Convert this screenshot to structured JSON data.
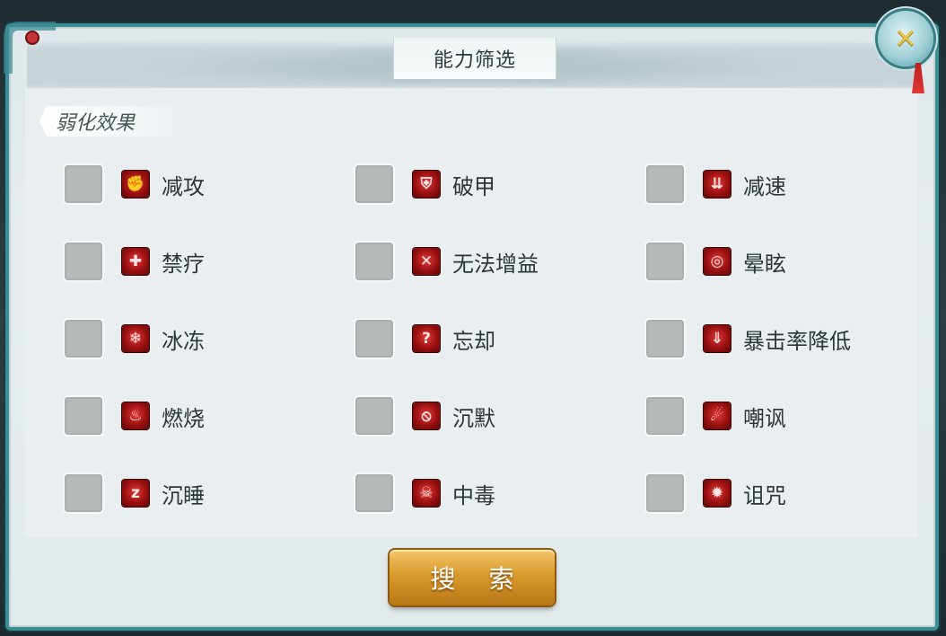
{
  "dialog": {
    "title": "能力筛选",
    "section_label": "弱化效果",
    "search_label": "搜 索",
    "close_icon": "✕"
  },
  "options": [
    {
      "label": "减攻",
      "icon": "attack-down-icon",
      "glyph": "✊",
      "checked": false
    },
    {
      "label": "破甲",
      "icon": "armor-break-icon",
      "glyph": "⛨",
      "checked": false
    },
    {
      "label": "减速",
      "icon": "slow-icon",
      "glyph": "⇊",
      "checked": false
    },
    {
      "label": "禁疗",
      "icon": "heal-block-icon",
      "glyph": "✚",
      "checked": false
    },
    {
      "label": "无法增益",
      "icon": "buff-block-icon",
      "glyph": "✕",
      "checked": false
    },
    {
      "label": "晕眩",
      "icon": "stun-icon",
      "glyph": "◎",
      "checked": false
    },
    {
      "label": "冰冻",
      "icon": "freeze-icon",
      "glyph": "❄",
      "checked": false
    },
    {
      "label": "忘却",
      "icon": "forget-icon",
      "glyph": "?",
      "checked": false
    },
    {
      "label": "暴击率降低",
      "icon": "crit-down-icon",
      "glyph": "⇓",
      "checked": false
    },
    {
      "label": "燃烧",
      "icon": "burn-icon",
      "glyph": "♨",
      "checked": false
    },
    {
      "label": "沉默",
      "icon": "silence-icon",
      "glyph": "⦸",
      "checked": false
    },
    {
      "label": "嘲讽",
      "icon": "taunt-icon",
      "glyph": "☄",
      "checked": false
    },
    {
      "label": "沉睡",
      "icon": "sleep-icon",
      "glyph": "z",
      "checked": false
    },
    {
      "label": "中毒",
      "icon": "poison-icon",
      "glyph": "☠",
      "checked": false
    },
    {
      "label": "诅咒",
      "icon": "curse-icon",
      "glyph": "✹",
      "checked": false
    }
  ],
  "colors": {
    "frame": "#3f8d95",
    "checkbox": "#b5b9ba",
    "icon_red": "#c41a1a",
    "button_gold": "#d99a2c"
  }
}
